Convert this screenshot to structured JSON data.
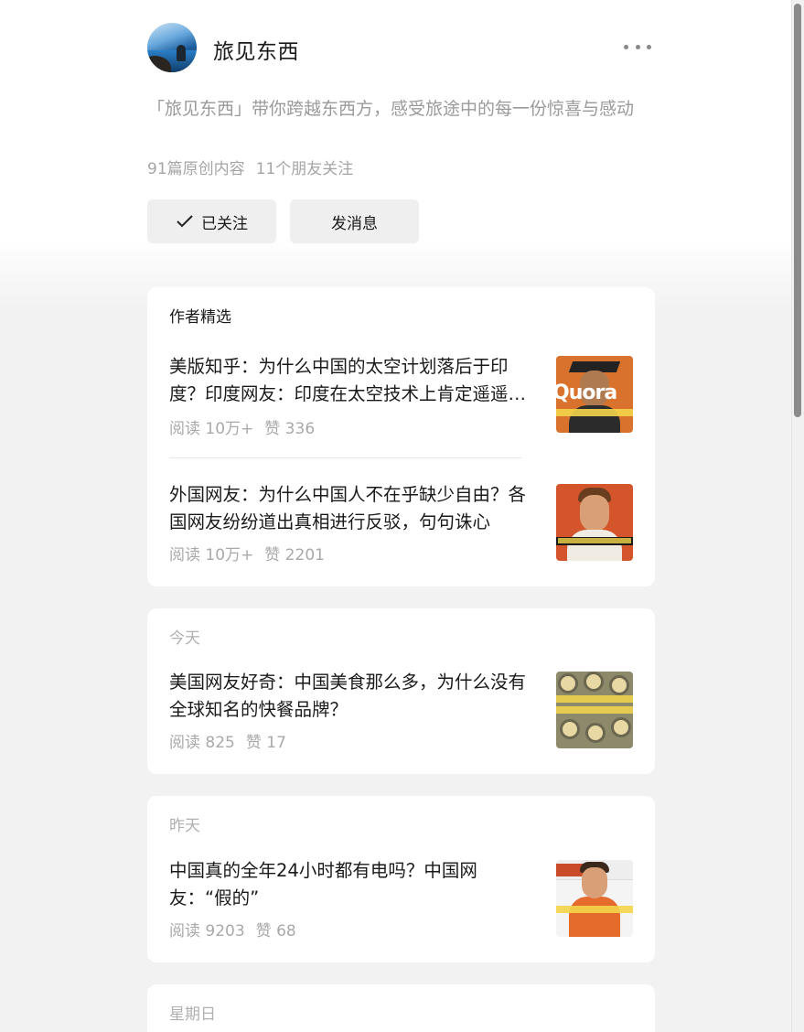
{
  "profile": {
    "name": "旅见东西",
    "bio": "「旅见东西」带你跨越东西方，感受旅途中的每一份惊喜与感动",
    "original_count": "91篇原创内容",
    "friends_following": "11个朋友关注",
    "follow_button": "已关注",
    "message_button": "发消息"
  },
  "featured": {
    "heading": "作者精选",
    "articles": [
      {
        "title": "美版知乎：为什么中国的太空计划落后于印度？印度网友：印度在太空技术上肯定遥遥领先",
        "reads": "阅读 10万+",
        "likes": "赞 336"
      },
      {
        "title": "外国网友：为什么中国人不在乎缺少自由？各国网友纷纷道出真相进行反驳，句句诛心",
        "reads": "阅读 10万+",
        "likes": "赞 2201"
      }
    ]
  },
  "sections": [
    {
      "heading": "今天",
      "article": {
        "title": "美国网友好奇：中国美食那么多，为什么没有全球知名的快餐品牌？",
        "reads": "阅读 825",
        "likes": "赞 17"
      }
    },
    {
      "heading": "昨天",
      "article": {
        "title": "中国真的全年24小时都有电吗？中国网友：“假的”",
        "reads": "阅读 9203",
        "likes": "赞 68"
      }
    },
    {
      "heading": "星期日"
    }
  ],
  "icons": {
    "more": "more-dots-icon",
    "check": "check-icon"
  }
}
